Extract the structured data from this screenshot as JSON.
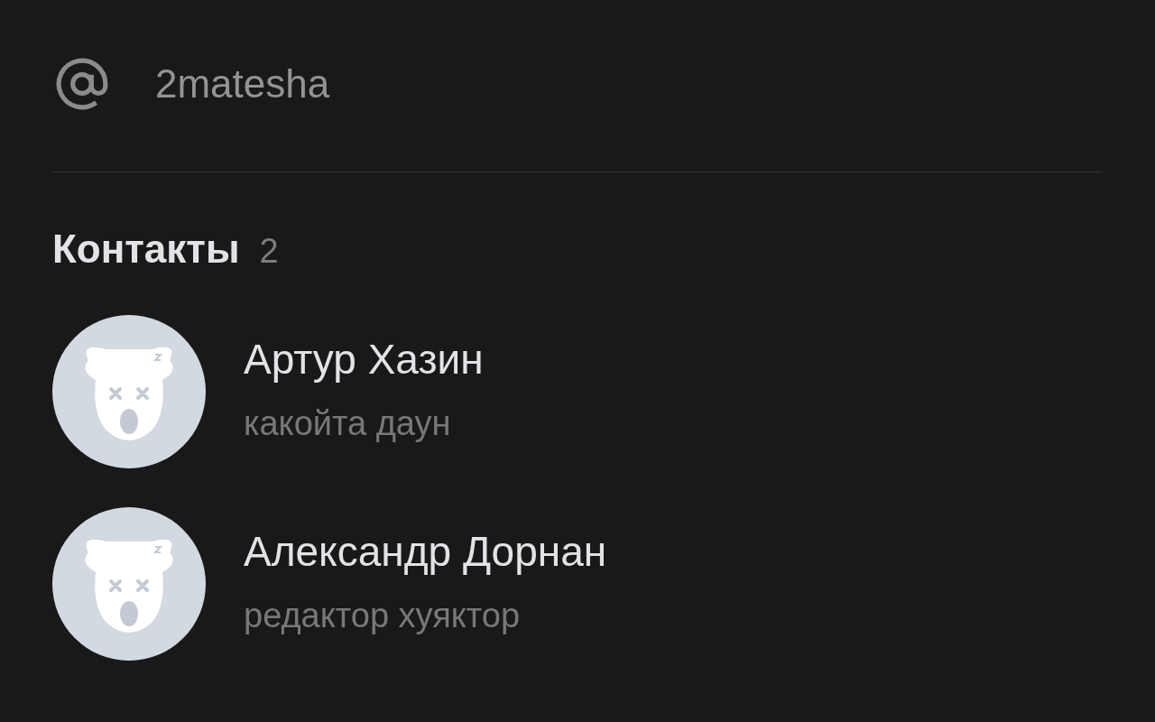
{
  "username": "2matesha",
  "contacts": {
    "title": "Контакты",
    "count": "2",
    "items": [
      {
        "name": "Артур Хазин",
        "status": "какойта даун"
      },
      {
        "name": "Александр Дорнан",
        "status": "редактор хуяктор"
      }
    ]
  }
}
